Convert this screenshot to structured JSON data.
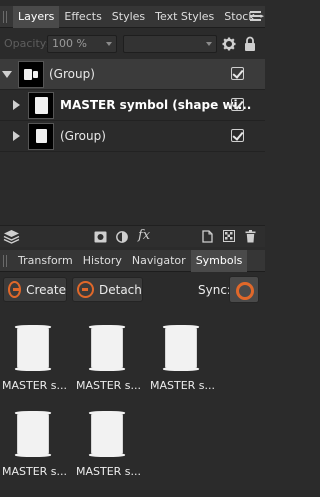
{
  "layers_panel": {
    "tabs": [
      "Layers",
      "Effects",
      "Styles",
      "Text Styles",
      "Stock"
    ],
    "active_tab": "Layers",
    "opacity_label": "Opacity:",
    "opacity_value": "100 %",
    "blend_mode_value": "",
    "layers": [
      {
        "label": "(Group)",
        "bold": false,
        "expanded": true,
        "visible": true
      },
      {
        "label": "MASTER symbol (shape wi...",
        "bold": true,
        "expanded": false,
        "visible": true
      },
      {
        "label": "(Group)",
        "bold": false,
        "expanded": false,
        "visible": true
      }
    ],
    "toolbar_icons": [
      "layers-stack-icon",
      "mask-icon",
      "adjustment-icon",
      "fx-icon",
      "new-layer-icon",
      "pixel-layer-icon",
      "trash-icon"
    ],
    "fx_label": "fx"
  },
  "symbols_panel": {
    "tabs": [
      "Transform",
      "History",
      "Navigator",
      "Symbols"
    ],
    "active_tab": "Symbols",
    "create_label": "Create",
    "detach_label": "Detach",
    "sync_label": "Sync:",
    "symbols": [
      {
        "name": "MASTER s..."
      },
      {
        "name": "MASTER s..."
      },
      {
        "name": "MASTER s..."
      },
      {
        "name": "MASTER s..."
      },
      {
        "name": "MASTER s..."
      }
    ]
  },
  "colors": {
    "panel_bg": "#2b2b2b",
    "tab_bar": "#363636",
    "active_tab": "#4a4a4a",
    "accent_orange": "#e0682a"
  }
}
